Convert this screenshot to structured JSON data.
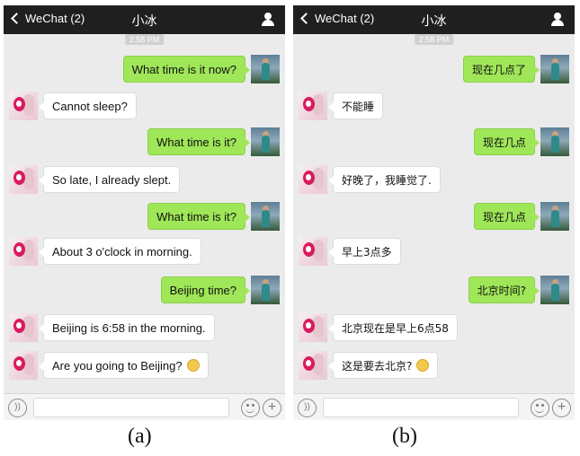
{
  "panels": [
    {
      "back_label": "WeChat (2)",
      "title": "小冰",
      "timestamp": "2:58 PM",
      "messages": [
        {
          "side": "user",
          "text": "What time is it now?"
        },
        {
          "side": "bot",
          "text": "Cannot sleep?"
        },
        {
          "side": "user",
          "text": "What time is it?"
        },
        {
          "side": "bot",
          "text": "So late, I already slept."
        },
        {
          "side": "user",
          "text": "What time is it?"
        },
        {
          "side": "bot",
          "text": "About 3 o'clock in morning."
        },
        {
          "side": "user",
          "text": "Beijing time?"
        },
        {
          "side": "bot",
          "text": "Beijing is 6:58 in the morning."
        },
        {
          "side": "bot",
          "text": "Are you going to Beijing?",
          "emoji": true
        }
      ],
      "caption": "(a)"
    },
    {
      "back_label": "WeChat (2)",
      "title": "小冰",
      "timestamp": "2:58 PM",
      "messages": [
        {
          "side": "user",
          "text": "现在几点了"
        },
        {
          "side": "bot",
          "text": "不能睡"
        },
        {
          "side": "user",
          "text": "现在几点"
        },
        {
          "side": "bot",
          "text": "好晚了，我睡觉了."
        },
        {
          "side": "user",
          "text": "现在几点"
        },
        {
          "side": "bot",
          "text": "早上3点多"
        },
        {
          "side": "user",
          "text": "北京时间?"
        },
        {
          "side": "bot",
          "text": "北京现在是早上6点58"
        },
        {
          "side": "bot",
          "text": "这是要去北京?",
          "emoji": true
        }
      ],
      "caption": "(b)"
    }
  ],
  "icons": {
    "back": "chevron-left-icon",
    "profile": "person-icon",
    "voice": "voice-icon",
    "emoji": "emoji-icon",
    "plus": "plus-icon"
  },
  "colors": {
    "topbar": "#1f1f1f",
    "chat_bg": "#ebebeb",
    "outgoing_bubble": "#9fe658",
    "incoming_bubble": "#ffffff"
  }
}
